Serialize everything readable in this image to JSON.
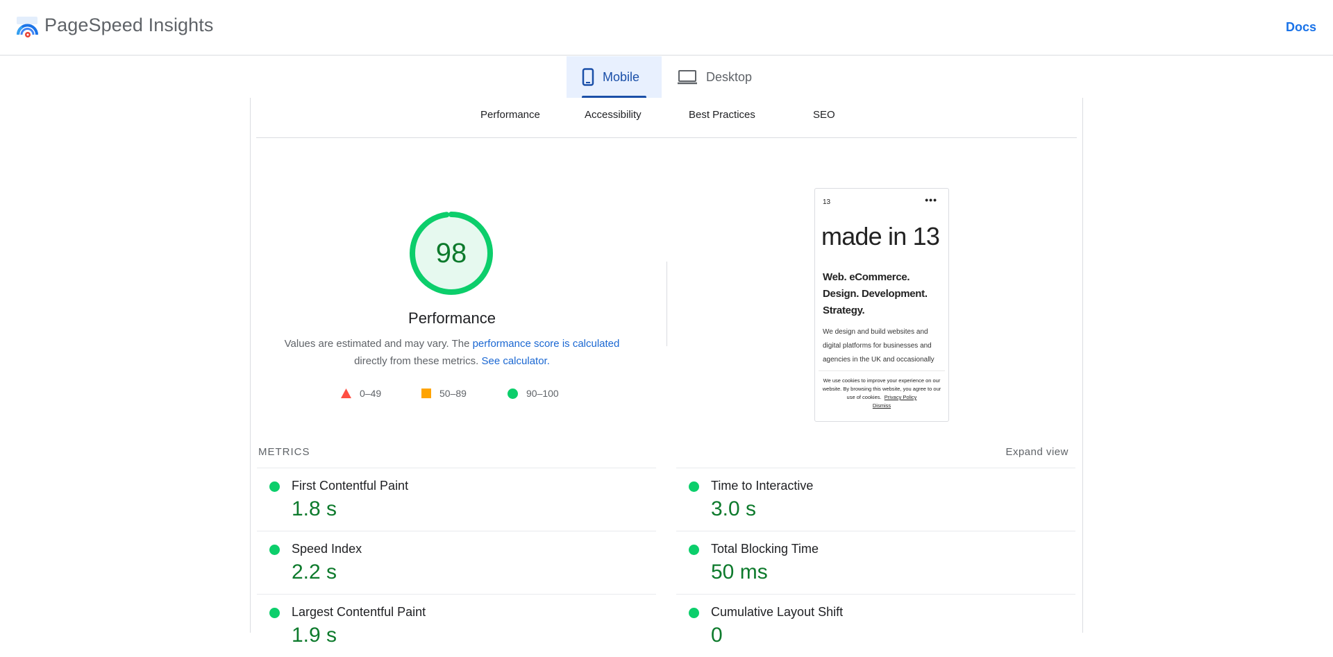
{
  "header": {
    "brand": "PageSpeed Insights",
    "logo_icon": "pagespeed-gauge-icon",
    "docs_link": "Docs"
  },
  "device_tabs": [
    {
      "label": "Mobile",
      "icon": "phone-icon",
      "active": true
    },
    {
      "label": "Desktop",
      "icon": "laptop-icon",
      "active": false
    }
  ],
  "category_tabs": [
    "Performance",
    "Accessibility",
    "Best Practices",
    "SEO"
  ],
  "performance": {
    "score": "98",
    "score_fraction": 0.98,
    "title": "Performance",
    "desc_prefix": "Values are estimated and may vary. The ",
    "desc_link1": "performance score is calculated",
    "desc_middle": " directly from these metrics. ",
    "desc_link2": "See calculator.",
    "legend": [
      {
        "label": "0–49",
        "shape": "triangle",
        "color": "#ff4e42"
      },
      {
        "label": "50–89",
        "shape": "square",
        "color": "#ffa400"
      },
      {
        "label": "90–100",
        "shape": "circle",
        "color": "#0cce6b"
      }
    ],
    "gauge_color": "#0cce6b",
    "gauge_fill": "#e6f9ef"
  },
  "screenshot": {
    "number": "13",
    "menu": "•••",
    "headline": "made in 13",
    "subhead": "Web. eCommerce. Design. Development. Strategy.",
    "body": "We design and build websites and digital platforms for businesses and agencies in the UK and occasionally",
    "cookie_text": "We use cookies to improve your experience on our website. By browsing this website, you agree to our use of cookies.",
    "cookie_policy": "Privacy Policy",
    "cookie_dismiss": "Dismiss"
  },
  "metrics": {
    "label": "METRICS",
    "expand": "Expand view",
    "left": [
      {
        "name": "First Contentful Paint",
        "value": "1.8 s"
      },
      {
        "name": "Speed Index",
        "value": "2.2 s"
      },
      {
        "name": "Largest Contentful Paint",
        "value": "1.9 s"
      }
    ],
    "right": [
      {
        "name": "Time to Interactive",
        "value": "3.0 s"
      },
      {
        "name": "Total Blocking Time",
        "value": "50 ms"
      },
      {
        "name": "Cumulative Layout Shift",
        "value": "0"
      }
    ],
    "good_color": "#0cce6b",
    "value_color": "#0d7a2c"
  }
}
